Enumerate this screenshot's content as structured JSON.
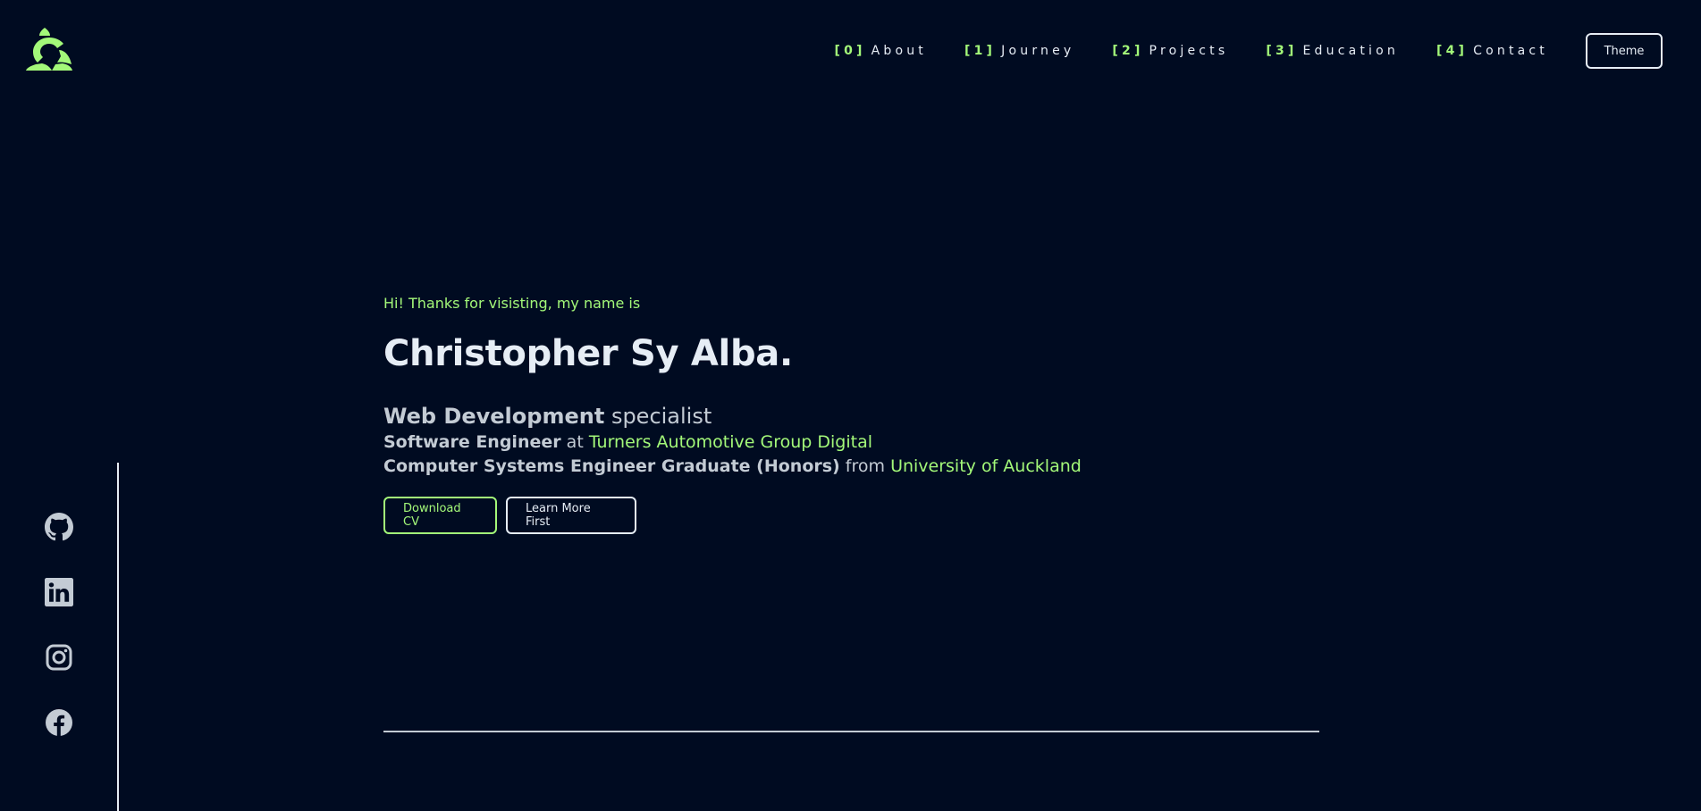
{
  "header": {
    "logo_icon": "stylized-c-logo-icon",
    "nav": [
      {
        "num": "[0]",
        "label": "About"
      },
      {
        "num": "[1]",
        "label": "Journey"
      },
      {
        "num": "[2]",
        "label": "Projects"
      },
      {
        "num": "[3]",
        "label": "Education"
      },
      {
        "num": "[4]",
        "label": "Contact"
      }
    ],
    "theme_label": "Theme"
  },
  "hero": {
    "greeting": "Hi! Thanks for visisting, my name is",
    "name": "Christopher Sy Alba.",
    "tagline_strong": "Web Development",
    "tagline_rest": "specialist",
    "role1_title": "Software Engineer",
    "role1_joiner": "at",
    "role1_org": "Turners Automotive Group Digital",
    "role2_title": "Computer Systems Engineer Graduate (Honors)",
    "role2_joiner": "from",
    "role2_org": "University of Auckland",
    "download_label": "Download CV",
    "learn_more_label": "Learn More First"
  },
  "social": [
    "github-icon",
    "linkedin-icon",
    "instagram-icon",
    "facebook-icon"
  ],
  "colors": {
    "background": "#000b21",
    "accent": "#a3f879",
    "text": "#e6edf5",
    "muted_text": "#c3cbd4"
  }
}
